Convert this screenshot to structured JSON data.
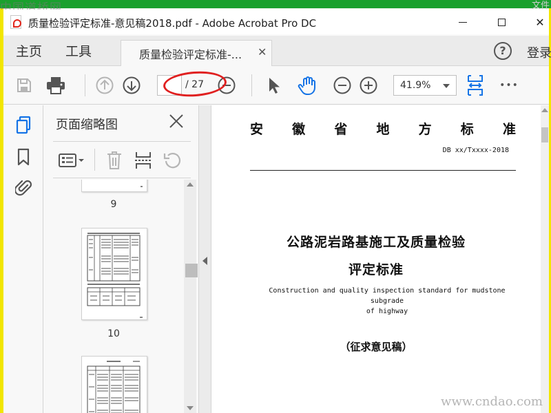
{
  "watermark": {
    "top_left": "中国道桥网",
    "bottom_right": "www.cndao.com",
    "top_right": "文件"
  },
  "window": {
    "title": "质量检验评定标准-意见稿2018.pdf - Adobe Acrobat Pro DC",
    "controls": {
      "minimize": "minimize",
      "maximize": "maximize",
      "close": "✕"
    }
  },
  "nav": {
    "home": "主页",
    "tools": "工具",
    "doc_tab": "质量检验评定标准-...",
    "doc_tab_close": "✕",
    "help": "?",
    "sign_in": "登录"
  },
  "toolbar": {
    "page_current": "",
    "page_total": "/ 27",
    "zoom": "41.9%",
    "more": "•••"
  },
  "thumbnails": {
    "title": "页面缩略图",
    "pages": [
      {
        "label": "9"
      },
      {
        "label": "10"
      },
      {
        "label": ""
      }
    ]
  },
  "document": {
    "header_chars": [
      "安",
      "徽",
      "省",
      "地",
      "方",
      "标",
      "准"
    ],
    "code": "DB xx/Txxxx-2018",
    "title_line1": "公路泥岩路基施工及质量检验",
    "title_line2": "评定标准",
    "english_line1": "Construction and quality inspection standard for mudstone subgrade",
    "english_line2": "of highway",
    "draft": "（征求意见稿）"
  },
  "colors": {
    "accent": "#1473e6",
    "annotation": "#e02020",
    "frame": "#f2e600",
    "topbar": "#1aa02e"
  },
  "icons": [
    "save-icon",
    "print-icon",
    "page-up-icon",
    "page-down-icon",
    "select-cursor-icon",
    "hand-icon",
    "zoom-out-icon",
    "zoom-in-icon",
    "fit-page-icon",
    "more-icon",
    "page-thumbnails-icon",
    "bookmark-icon",
    "attachment-icon",
    "close-icon",
    "thumbnail-options-icon",
    "delete-icon",
    "insert-page-icon",
    "rotate-icon"
  ]
}
